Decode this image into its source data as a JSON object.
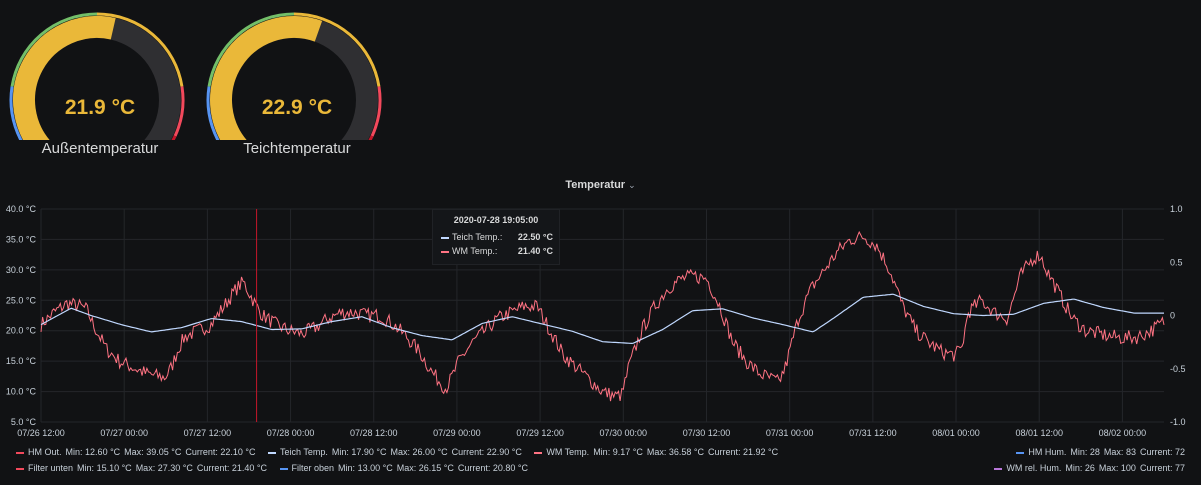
{
  "gauges": [
    {
      "title": "Außentemperatur",
      "value_text": "21.9 °C",
      "value": 21.9,
      "min": 0,
      "max": 40
    },
    {
      "title": "Teichtemperatur",
      "value_text": "22.9 °C",
      "value": 22.9,
      "min": 0,
      "max": 40
    }
  ],
  "colors": {
    "gauge_fill": "#eab839",
    "gauge_track": "#2f2f32",
    "threshold_low": "#5794f2",
    "threshold_ok": "#73bf69",
    "threshold_warm": "#eab839",
    "threshold_hot": "#f2495c",
    "threshold_extreme": "#c4162a"
  },
  "panel": {
    "title": "Temperatur",
    "chevron": "chevron-down-icon"
  },
  "tooltip": {
    "time": "2020-07-28 19:05:00",
    "rows": [
      {
        "name": "Teich Temp.:",
        "value": "22.50 °C",
        "color": "#c0d8ff"
      },
      {
        "name": "WM Temp.:",
        "value": "21.40 °C",
        "color": "#ff7383"
      }
    ]
  },
  "legend": {
    "row1": [
      {
        "name": "HM Out.",
        "color": "#f2495c",
        "min": "12.60 °C",
        "max": "39.05 °C",
        "current": "22.10 °C"
      },
      {
        "name": "Teich Temp.",
        "color": "#c0d8ff",
        "min": "17.90 °C",
        "max": "26.00 °C",
        "current": "22.90 °C"
      },
      {
        "name": "WM Temp.",
        "color": "#ff7383",
        "min": "9.17 °C",
        "max": "36.58 °C",
        "current": "21.92 °C"
      }
    ],
    "row2": [
      {
        "name": "Filter unten",
        "color": "#f2495c",
        "min": "15.10 °C",
        "max": "27.30 °C",
        "current": "21.40 °C"
      },
      {
        "name": "Filter oben",
        "color": "#5794f2",
        "min": "13.00 °C",
        "max": "26.15 °C",
        "current": "20.80 °C"
      }
    ],
    "right": [
      {
        "name": "HM Hum.",
        "color": "#5794f2",
        "min": "28",
        "max": "83",
        "current": "72"
      },
      {
        "name": "WM rel. Hum.",
        "color": "#b877d9",
        "min": "26",
        "max": "100",
        "current": "77"
      }
    ],
    "labels": {
      "min": "Min:",
      "max": "Max:",
      "current": "Current:"
    }
  },
  "chart_data": {
    "type": "line",
    "title": "Temperatur",
    "y_left_ticks": [
      "40.0 °C",
      "35.0 °C",
      "30.0 °C",
      "25.0 °C",
      "20.0 °C",
      "15.0 °C",
      "10.0 °C",
      "5.0 °C"
    ],
    "y_left_range": [
      5,
      40
    ],
    "y_right_ticks": [
      "1.0",
      "0.5",
      "0",
      "-0.5",
      "-1.0"
    ],
    "y_right_range": [
      -1,
      1
    ],
    "x_ticks": [
      "07/26 12:00",
      "07/27 00:00",
      "07/27 12:00",
      "07/28 00:00",
      "07/28 12:00",
      "07/29 00:00",
      "07/29 12:00",
      "07/30 00:00",
      "07/30 12:00",
      "07/31 00:00",
      "07/31 12:00",
      "08/01 00:00",
      "08/01 12:00",
      "08/02 00:00"
    ],
    "x_range_hours": [
      0,
      162
    ],
    "crosshair_hour": 31.1,
    "grid": true,
    "series": [
      {
        "name": "WM Temp.",
        "color": "#ff7383",
        "noise": 1.2,
        "points": [
          [
            0,
            21
          ],
          [
            2,
            23
          ],
          [
            4,
            24.5
          ],
          [
            6,
            24
          ],
          [
            7,
            23.5
          ],
          [
            8,
            21
          ],
          [
            10,
            17
          ],
          [
            12,
            15
          ],
          [
            14,
            14
          ],
          [
            16,
            13
          ],
          [
            18,
            12.5
          ],
          [
            19,
            12.3
          ],
          [
            20,
            14
          ],
          [
            21,
            17
          ],
          [
            22,
            19
          ],
          [
            24,
            20
          ],
          [
            26,
            21
          ],
          [
            28,
            24
          ],
          [
            30,
            27
          ],
          [
            31,
            28
          ],
          [
            32,
            26
          ],
          [
            33,
            24
          ],
          [
            34,
            22.5
          ],
          [
            36,
            21
          ],
          [
            38,
            20
          ],
          [
            40,
            19.5
          ],
          [
            42,
            20.5
          ],
          [
            44,
            22
          ],
          [
            46,
            23
          ],
          [
            48,
            23
          ],
          [
            50,
            22.5
          ],
          [
            52,
            22.5
          ],
          [
            54,
            21
          ],
          [
            56,
            19
          ],
          [
            58,
            16.5
          ],
          [
            60,
            13
          ],
          [
            62,
            10.5
          ],
          [
            63,
            12.5
          ],
          [
            64,
            15
          ],
          [
            66,
            18
          ],
          [
            68,
            20
          ],
          [
            70,
            22
          ],
          [
            72,
            23
          ],
          [
            74,
            24
          ],
          [
            76,
            24
          ],
          [
            78,
            20
          ],
          [
            80,
            16
          ],
          [
            82,
            14
          ],
          [
            84,
            12
          ],
          [
            86,
            10
          ],
          [
            88,
            9.2
          ],
          [
            89,
            9.5
          ],
          [
            90,
            14
          ],
          [
            92,
            20
          ],
          [
            94,
            24
          ],
          [
            96,
            27
          ],
          [
            98,
            28.5
          ],
          [
            100,
            29
          ],
          [
            102,
            28.5
          ],
          [
            104,
            24
          ],
          [
            106,
            18
          ],
          [
            108,
            15
          ],
          [
            110,
            13
          ],
          [
            112,
            12
          ],
          [
            113,
            11.5
          ],
          [
            114,
            14
          ],
          [
            116,
            22
          ],
          [
            118,
            27
          ],
          [
            120,
            30
          ],
          [
            122,
            33
          ],
          [
            124,
            35
          ],
          [
            126,
            35.5
          ],
          [
            128,
            34
          ],
          [
            130,
            30
          ],
          [
            132,
            24
          ],
          [
            134,
            20
          ],
          [
            136,
            18
          ],
          [
            138,
            16.5
          ],
          [
            140,
            16
          ],
          [
            141,
            17
          ],
          [
            142,
            23
          ],
          [
            144,
            25
          ],
          [
            146,
            23
          ],
          [
            148,
            22
          ],
          [
            150,
            29
          ],
          [
            152,
            32
          ],
          [
            153,
            32.5
          ],
          [
            154,
            30
          ],
          [
            156,
            26
          ],
          [
            158,
            22
          ],
          [
            160,
            20
          ],
          [
            162,
            19.5
          ],
          [
            164,
            19
          ],
          [
            166,
            18.8
          ],
          [
            168,
            19
          ],
          [
            170,
            20
          ],
          [
            172,
            21.5
          ]
        ]
      },
      {
        "name": "Teich Temp.",
        "color": "#c0d8ff",
        "noise": 0,
        "points": [
          [
            0,
            21
          ],
          [
            6,
            23.7
          ],
          [
            10,
            22.5
          ],
          [
            16,
            21
          ],
          [
            22,
            19.8
          ],
          [
            28,
            20.5
          ],
          [
            34,
            22
          ],
          [
            40,
            21.5
          ],
          [
            46,
            20.2
          ],
          [
            52,
            20.3
          ],
          [
            58,
            21.5
          ],
          [
            64,
            22.3
          ],
          [
            70,
            20.5
          ],
          [
            76,
            19.2
          ],
          [
            82,
            18.5
          ],
          [
            88,
            21.2
          ],
          [
            94,
            22.3
          ],
          [
            100,
            21.1
          ],
          [
            106,
            19.9
          ],
          [
            112,
            18.2
          ],
          [
            118,
            17.9
          ],
          [
            124,
            20.2
          ],
          [
            130,
            23.3
          ],
          [
            136,
            23.6
          ],
          [
            142,
            22.1
          ],
          [
            148,
            21.0
          ],
          [
            154,
            19.8
          ],
          [
            158,
            22.0
          ],
          [
            164,
            25.5
          ],
          [
            170,
            26.0
          ],
          [
            176,
            24.0
          ],
          [
            182,
            22.8
          ],
          [
            188,
            22.5
          ],
          [
            194,
            22.7
          ],
          [
            200,
            24.5
          ],
          [
            206,
            25.2
          ],
          [
            212,
            23.8
          ],
          [
            218,
            22.9
          ],
          [
            224,
            22.9
          ]
        ]
      }
    ]
  }
}
